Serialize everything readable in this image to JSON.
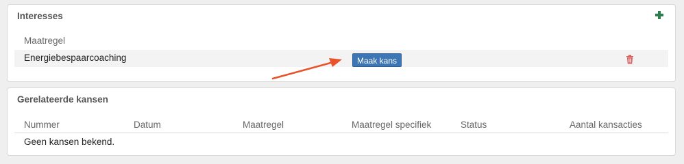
{
  "interesses": {
    "title": "Interesses",
    "column_header": "Maatregel",
    "rows": [
      {
        "maatregel": "Energiebespaarcoaching",
        "action_label": "Maak kans"
      }
    ]
  },
  "kansen": {
    "title": "Gerelateerde kansen",
    "columns": [
      "Nummer",
      "Datum",
      "Maatregel",
      "Maatregel specifiek",
      "Status",
      "Aantal kansacties"
    ],
    "empty_text": "Geen kansen bekend."
  },
  "colors": {
    "accent_green": "#2e7d4f",
    "button_blue": "#3c76b5",
    "delete_red": "#d9534f",
    "annotation_arrow": "#e8532b"
  },
  "icons": {
    "add": "plus-icon",
    "delete": "trash-icon",
    "annotation": "arrow-annotation"
  }
}
